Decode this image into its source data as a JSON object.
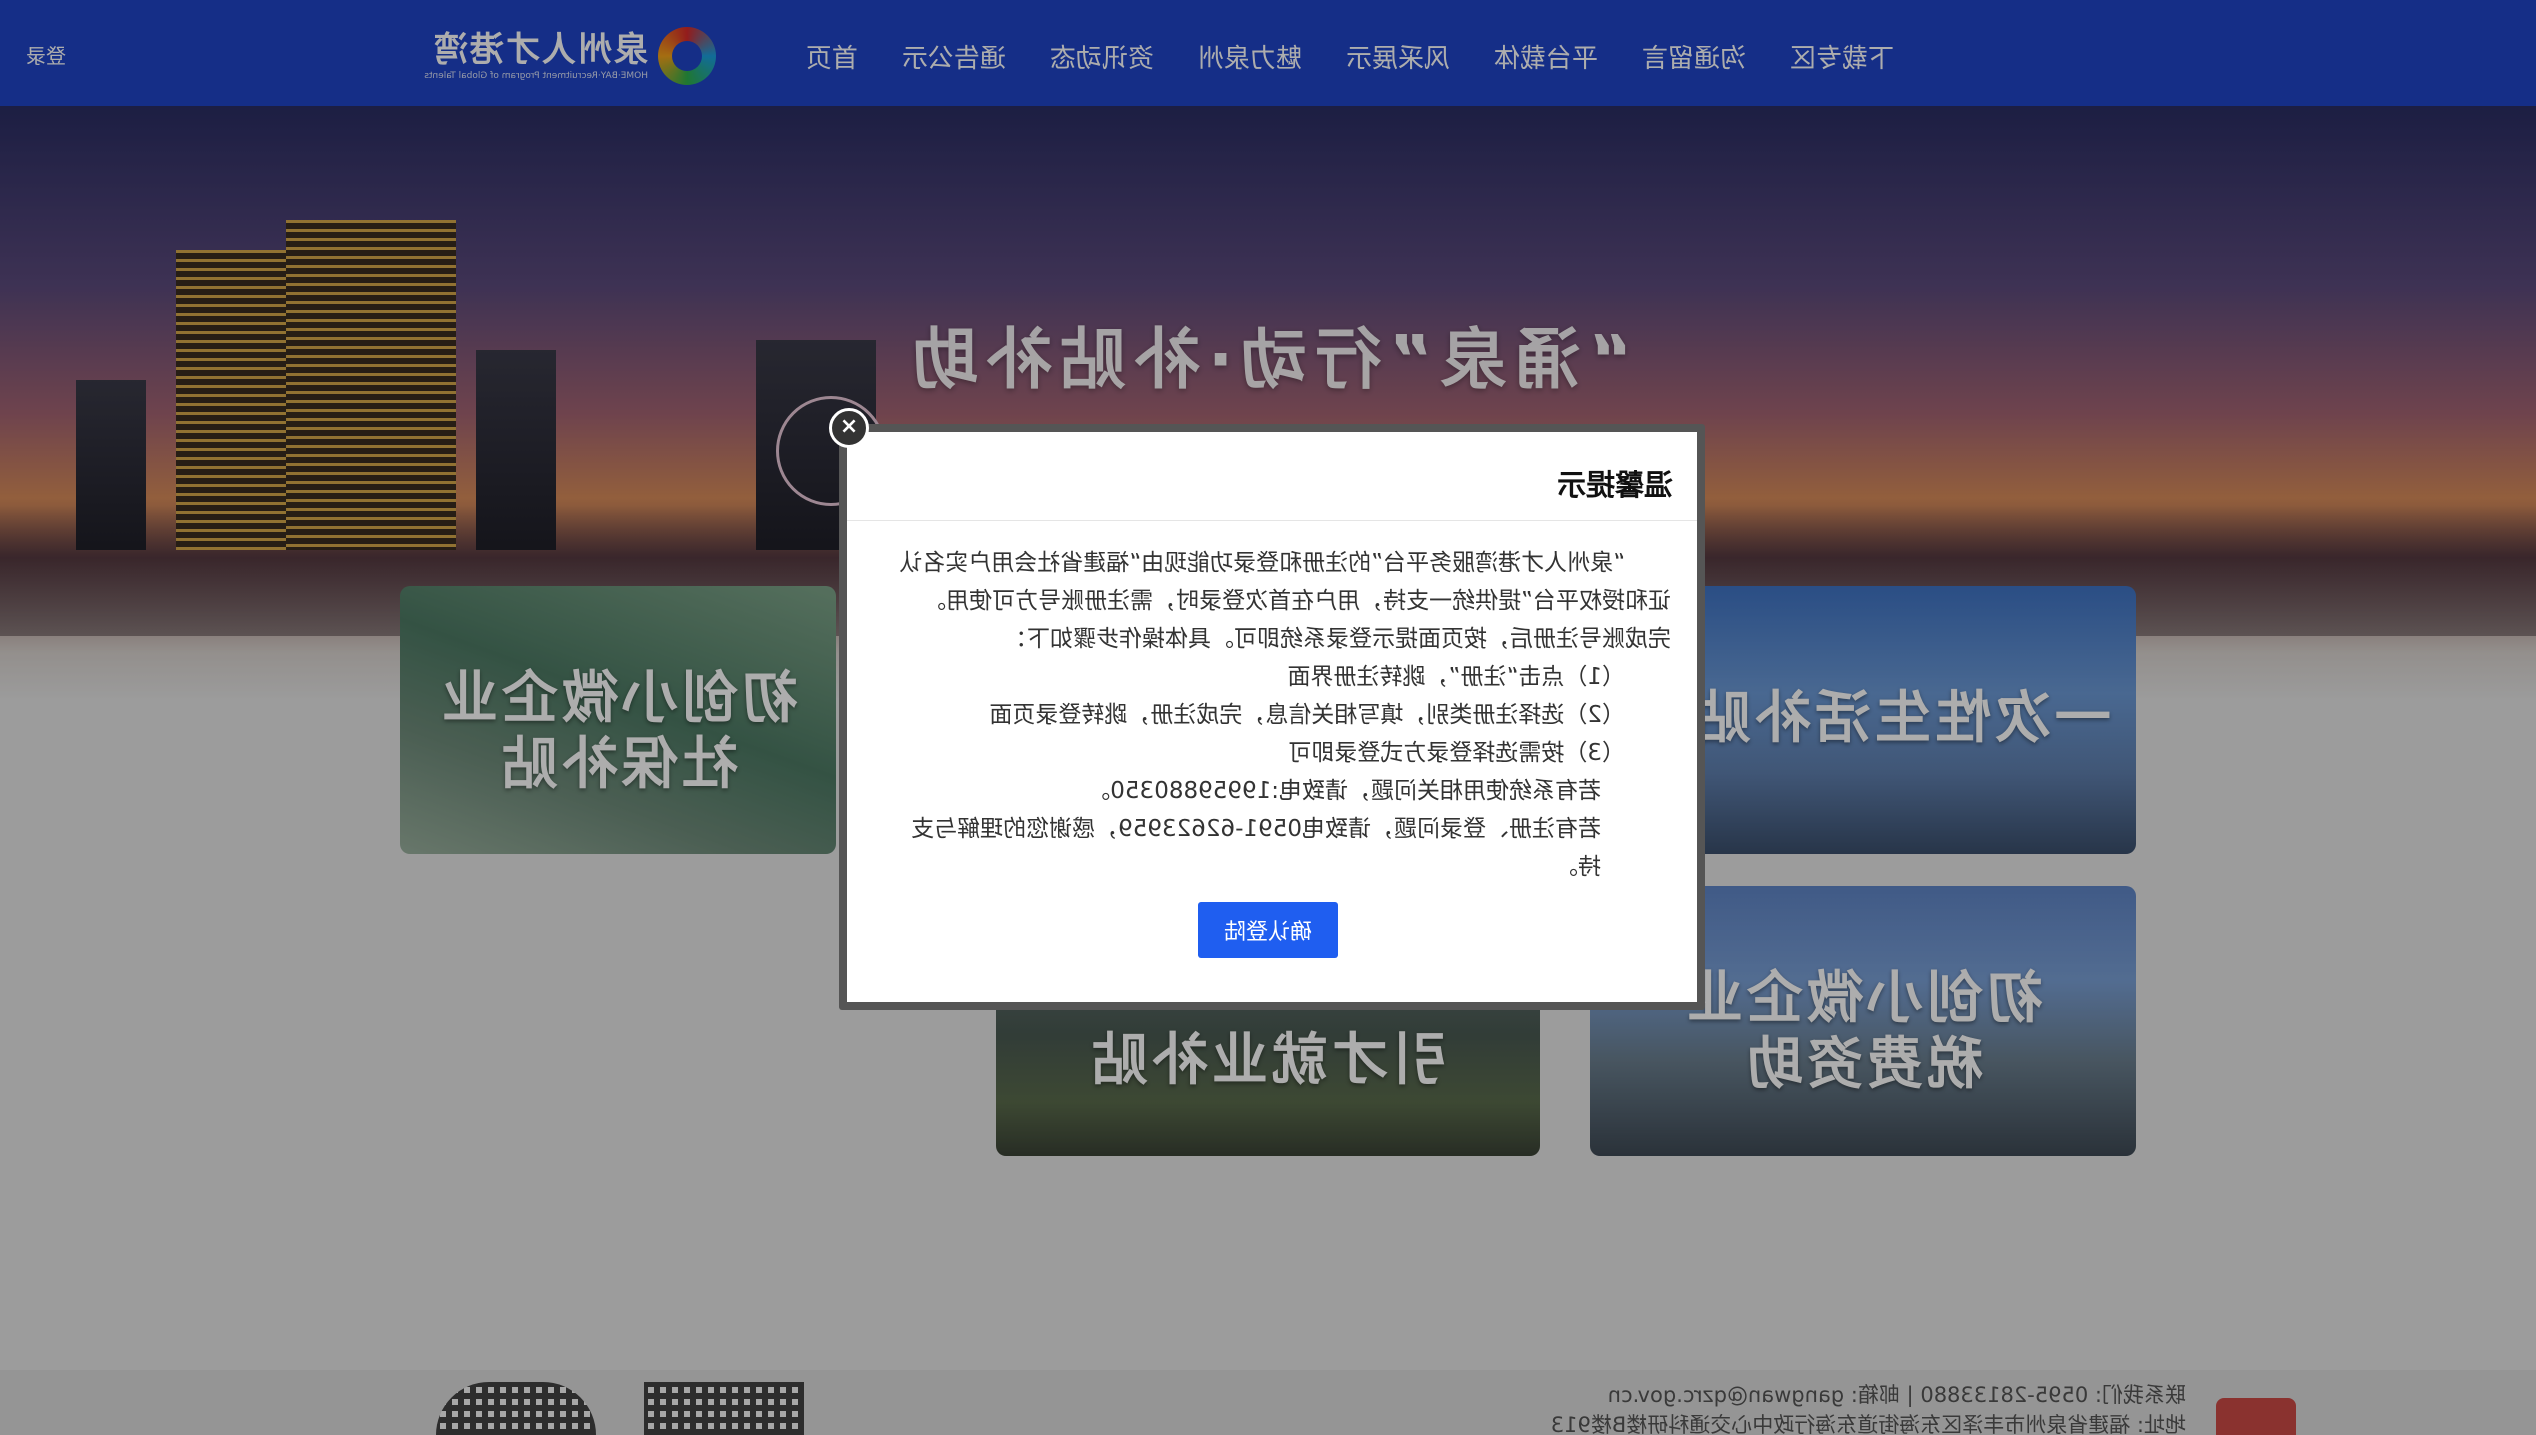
{
  "header": {
    "logo_name": "泉州人才港湾",
    "logo_sub": "HOME·BAY·Recruitment Program of Global Talents",
    "nav": [
      "首页",
      "通告公示",
      "资讯动态",
      "魅力泉州",
      "风采展示",
      "平台载体",
      "沟通留言",
      "下载专区"
    ],
    "login": "登录"
  },
  "banner": {
    "title": "“涌泉”行动·补贴补助"
  },
  "cards": [
    {
      "label_line1": "初创小微企业",
      "label_line2": "社保补贴"
    },
    {
      "label_line1": "一次性生活补贴",
      "label_line2": ""
    },
    {
      "label_line1": "引才就业补贴",
      "label_line2": ""
    },
    {
      "label_line1": "初创小微企业",
      "label_line2": "税费资助"
    }
  ],
  "footer": {
    "contact": "联系我们: 0595-28133880 | 邮箱: gangwan@qzrc.gov.cn",
    "address": "地址: 福建省泉州市丰泽区东海街道东海行政中心交通科研楼B楼913"
  },
  "modal": {
    "title": "温馨提示",
    "lines": [
      "“泉州人才港湾服务平台”的注册和登录功能现由“福建省社会用户实名认",
      "证和授权平台”提供统一支持，用户在首次登录时，需注册账号方可使用。",
      "完成账号注册后，按页面提示登录系统即可。具体操作步骤如下：",
      "（1）点击“注册”，跳转注册界面",
      "（2）选择注册类别，填写相关信息，完成注册，跳转登录页面",
      "（3）按需选择登录方式登录即可",
      "若有系统使用相关问题，请致电:19959880350。",
      "若有注册、登录问题，请致电0591-62623959，感谢您的理解与支持。"
    ],
    "confirm_label": "确认登陆",
    "close_glyph": "×"
  }
}
